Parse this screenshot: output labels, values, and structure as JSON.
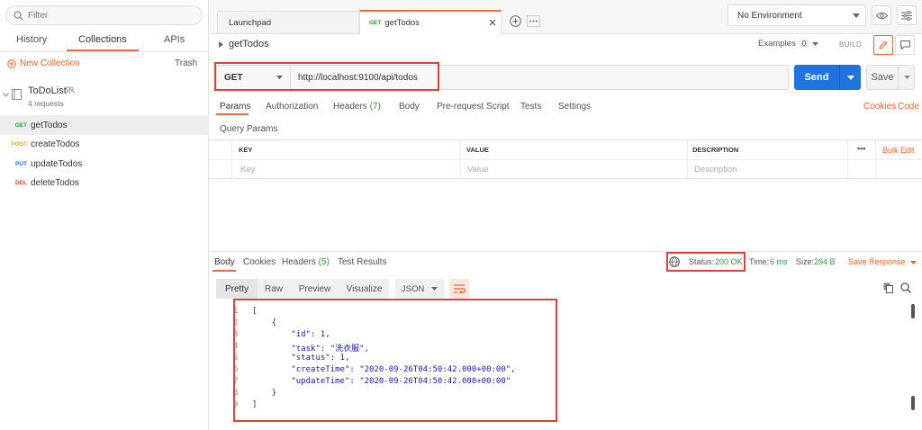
{
  "sidebar": {
    "filter_placeholder": "Filter",
    "tabs": [
      "History",
      "Collections",
      "APIs"
    ],
    "new_collection": "New Collection",
    "trash": "Trash",
    "collection": {
      "name": "ToDoList",
      "count": "4 requests"
    },
    "requests": [
      {
        "method": "GET",
        "name": "getTodos",
        "color": "#2e9b3a"
      },
      {
        "method": "POST",
        "name": "createTodos",
        "color": "#f5a623"
      },
      {
        "method": "PUT",
        "name": "updateTodos",
        "color": "#1f74e0"
      },
      {
        "method": "DEL",
        "name": "deleteTodos",
        "color": "#d9443a"
      }
    ]
  },
  "tabs": {
    "launchpad": "Launchpad",
    "active_method": "GET",
    "active_name": "getTodos"
  },
  "environment": "No Environment",
  "request": {
    "title": "getTodos",
    "examples_label": "Examples",
    "examples_count": "0",
    "build_label": "BUILD",
    "method": "GET",
    "url": "http://localhost:9100/api/todos",
    "send_label": "Send",
    "save_label": "Save",
    "tabs": [
      "Params",
      "Authorization",
      "Headers",
      "Body",
      "Pre-request Script",
      "Tests",
      "Settings"
    ],
    "headers_count": "(7)",
    "links": [
      "Cookies",
      "Code"
    ],
    "query_params_label": "Query Params",
    "table": {
      "headers": [
        "KEY",
        "VALUE",
        "DESCRIPTION"
      ],
      "placeholders": [
        "Key",
        "Value",
        "Description"
      ],
      "more": "•••",
      "bulk_edit": "Bulk Edit"
    }
  },
  "response": {
    "tabs": [
      "Body",
      "Cookies",
      "Headers",
      "Test Results"
    ],
    "headers_count": "(5)",
    "status_label": "Status:",
    "status_value": "200 OK",
    "time_label": "Time:",
    "time_value": "6 ms",
    "size_label": "Size:",
    "size_value": "294 B",
    "save_response": "Save Response",
    "views": [
      "Pretty",
      "Raw",
      "Preview",
      "Visualize"
    ],
    "format": "JSON",
    "body_lines": [
      "[",
      "    {",
      "        \"id\": 1,",
      "        \"task\": \"洗衣服\",",
      "        \"status\": 1,",
      "        \"createTime\": \"2020-09-26T04:50:42.000+00:00\",",
      "        \"updateTime\": \"2020-09-26T04:50:42.000+00:00\"",
      "    }",
      "]"
    ]
  },
  "colors": {
    "accent": "#f26b3a",
    "send_button": "#1f74e0",
    "status_ok": "#2e9b3a",
    "highlight_box": "#d9443a"
  }
}
